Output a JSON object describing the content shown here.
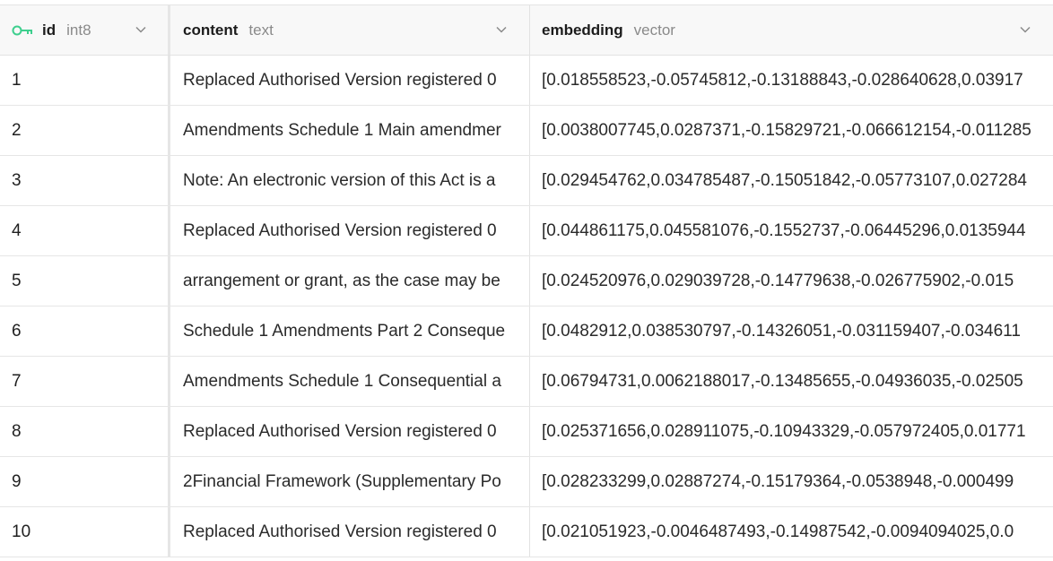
{
  "columns": [
    {
      "name": "id",
      "type": "int8"
    },
    {
      "name": "content",
      "type": "text"
    },
    {
      "name": "embedding",
      "type": "vector"
    }
  ],
  "rows": [
    {
      "id": "1",
      "content": "Replaced Authorised Version registered 0",
      "embedding": "[0.018558523,-0.05745812,-0.13188843,-0.028640628,0.03917"
    },
    {
      "id": "2",
      "content": "Amendments Schedule 1 Main amendmer",
      "embedding": "[0.0038007745,0.0287371,-0.15829721,-0.066612154,-0.011285"
    },
    {
      "id": "3",
      "content": "Note: An electronic version of this Act is a",
      "embedding": "[0.029454762,0.034785487,-0.15051842,-0.05773107,0.027284"
    },
    {
      "id": "4",
      "content": "Replaced Authorised Version registered 0",
      "embedding": "[0.044861175,0.045581076,-0.1552737,-0.06445296,0.0135944"
    },
    {
      "id": "5",
      "content": "arrangement or grant, as the case may be",
      "embedding": "[0.024520976,0.029039728,-0.14779638,-0.026775902,-0.015"
    },
    {
      "id": "6",
      "content": "Schedule 1 Amendments Part 2 Conseque",
      "embedding": "[0.0482912,0.038530797,-0.14326051,-0.031159407,-0.034611"
    },
    {
      "id": "7",
      "content": "Amendments Schedule 1 Consequential a",
      "embedding": "[0.06794731,0.0062188017,-0.13485655,-0.04936035,-0.02505"
    },
    {
      "id": "8",
      "content": "Replaced Authorised Version registered 0",
      "embedding": "[0.025371656,0.028911075,-0.10943329,-0.057972405,0.01771"
    },
    {
      "id": "9",
      "content": "2Financial Framework (Supplementary Po",
      "embedding": "[0.028233299,0.02887274,-0.15179364,-0.0538948,-0.000499"
    },
    {
      "id": "10",
      "content": "Replaced Authorised Version registered 0",
      "embedding": "[0.021051923,-0.0046487493,-0.14987542,-0.0094094025,0.0"
    }
  ],
  "colors": {
    "key_icon": "#3ecf8e",
    "type_text": "#8a8a8a"
  }
}
